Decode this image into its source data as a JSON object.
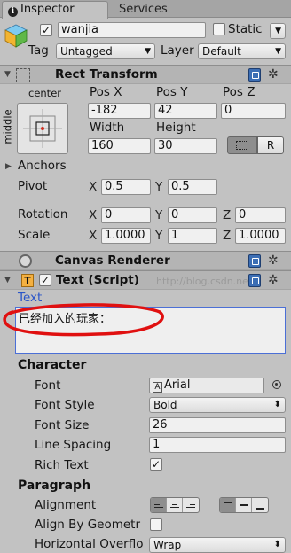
{
  "tabs": {
    "inspector": "Inspector",
    "services": "Services"
  },
  "object": {
    "name": "wanjia",
    "static_label": "Static",
    "tag_label": "Tag",
    "tag_value": "Untagged",
    "layer_label": "Layer",
    "layer_value": "Default"
  },
  "rect_transform": {
    "title": "Rect Transform",
    "anchor_h": "center",
    "anchor_v": "middle",
    "pos_x_label": "Pos X",
    "pos_y_label": "Pos Y",
    "pos_z_label": "Pos Z",
    "pos_x": "-182",
    "pos_y": "42",
    "pos_z": "0",
    "width_label": "Width",
    "height_label": "Height",
    "width": "160",
    "height": "30",
    "r_button": "R",
    "anchors_label": "Anchors",
    "pivot_label": "Pivot",
    "pivot_x": "0.5",
    "pivot_y": "0.5",
    "rotation_label": "Rotation",
    "rot_x": "0",
    "rot_y": "0",
    "rot_z": "0",
    "scale_label": "Scale",
    "scale_x": "1.0000",
    "scale_y": "1",
    "scale_z": "1.0000",
    "x": "X",
    "y": "Y",
    "z": "Z"
  },
  "canvas_renderer": {
    "title": "Canvas Renderer"
  },
  "text_script": {
    "title": "Text (Script)",
    "watermark": "http://blog.csdn.net/",
    "text_label": "Text",
    "text_value": "已经加入的玩家：",
    "character_label": "Character",
    "font_label": "Font",
    "font_value": "Arial",
    "font_style_label": "Font Style",
    "font_style_value": "Bold",
    "font_size_label": "Font Size",
    "font_size_value": "26",
    "line_spacing_label": "Line Spacing",
    "line_spacing_value": "1",
    "rich_text_label": "Rich Text",
    "rich_text_checked": true,
    "paragraph_label": "Paragraph",
    "alignment_label": "Alignment",
    "align_by_geometry_label": "Align By Geometr",
    "horizontal_overflow_label": "Horizontal Overflo",
    "horizontal_overflow_value": "Wrap"
  },
  "colors": {
    "panel_bg": "#c2c2c2",
    "header_bg": "#b4b4b4",
    "link_blue": "#2a55c8",
    "annotation_red": "#e01010"
  }
}
